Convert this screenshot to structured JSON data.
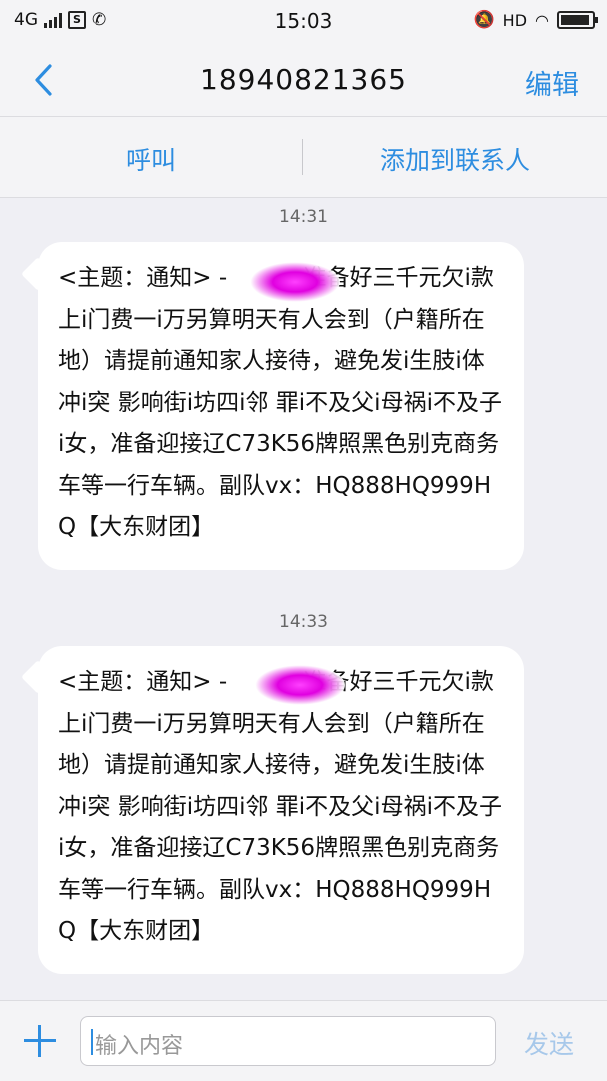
{
  "status_bar": {
    "network": "4G",
    "time": "15:03",
    "hd": "HD",
    "battery_level": 0.92
  },
  "nav": {
    "title": "18940821365",
    "edit_label": "编辑"
  },
  "actions": {
    "call_label": "呼叫",
    "add_contact_label": "添加到联系人"
  },
  "messages": [
    {
      "time": "14:31",
      "text": "<主题：通知> - 　　　准备好三千元欠i款上i门费一i万另算明天有人会到（户籍所在地）请提前通知家人接待，避免发i生肢i体冲i突 影响街i坊四i邻 罪i不及父i母祸i不及子i女，准备迎接辽C73K56牌照黑色别克商务车等一行车辆。副队vx：HQ888HQ999HQ【大东财团】"
    },
    {
      "time": "14:33",
      "text": "<主题：通知> - 　　　准备好三千元欠i款上i门费一i万另算明天有人会到（户籍所在地）请提前通知家人接待，避免发i生肢i体冲i突 影响街i坊四i邻 罪i不及父i母祸i不及子i女，准备迎接辽C73K56牌照黑色别克商务车等一行车辆。副队vx：HQ888HQ999HQ【大东财团】"
    }
  ],
  "composer": {
    "placeholder": "输入内容",
    "send_label": "发送"
  },
  "colors": {
    "accent": "#2d8de0",
    "send_disabled": "#a7c8ea",
    "background": "#efeff4",
    "bubble": "#ffffff"
  },
  "icons": {
    "back": "chevron-left-icon",
    "add": "plus-icon"
  }
}
